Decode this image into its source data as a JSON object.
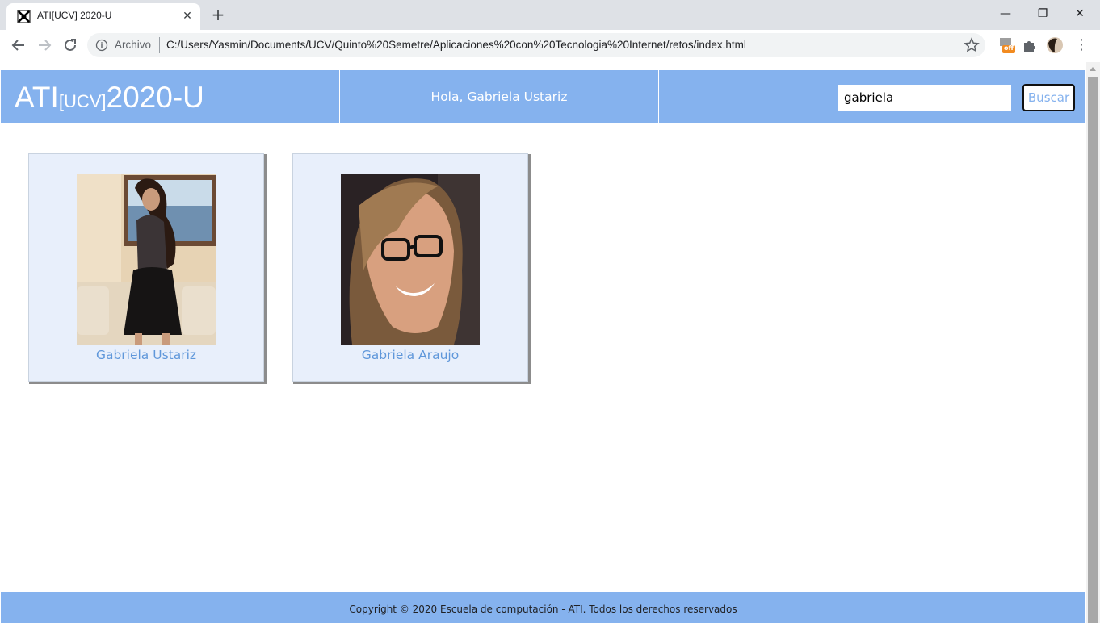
{
  "browser": {
    "tab_title": "ATI[UCV] 2020-U",
    "scheme_label": "Archivo",
    "url": "C:/Users/Yasmin/Documents/UCV/Quinto%20Semetre/Aplicaciones%20con%20Tecnologia%20Internet/retos/index.html",
    "extension_badge": "off"
  },
  "header": {
    "logo_main": "ATI",
    "logo_sub": "[UCV]",
    "logo_year": "2020-U",
    "greeting": "Hola, Gabriela Ustariz",
    "search_value": "gabriela",
    "search_button": "Buscar"
  },
  "results": [
    {
      "name": "Gabriela Ustariz"
    },
    {
      "name": "Gabriela Araujo"
    }
  ],
  "footer": {
    "text": "Copyright © 2020 Escuela de computación - ATI. Todos los derechos reservados"
  },
  "colors": {
    "brand_blue": "#85b2ee",
    "link_blue": "#5f97da",
    "card_bg": "#e8effb"
  }
}
